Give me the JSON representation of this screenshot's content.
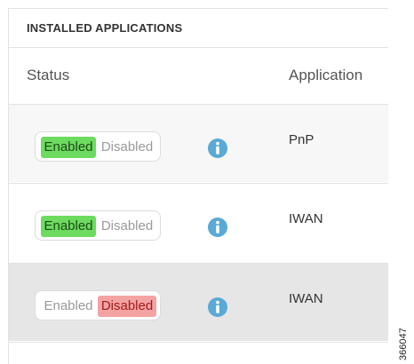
{
  "panel": {
    "title": "INSTALLED APPLICATIONS",
    "columns": {
      "status": "Status",
      "application": "Application"
    }
  },
  "rows": [
    {
      "enabled_label": "Enabled",
      "disabled_label": "Disabled",
      "state": "enabled",
      "info_icon": "info-icon",
      "application": "PnP"
    },
    {
      "enabled_label": "Enabled",
      "disabled_label": "Disabled",
      "state": "enabled",
      "info_icon": "info-icon",
      "application": "IWAN"
    },
    {
      "enabled_label": "Enabled",
      "disabled_label": "Disabled",
      "state": "disabled",
      "info_icon": "info-icon",
      "application": "IWAN"
    }
  ],
  "figure_id": "366047",
  "colors": {
    "enabled_active": "#6cdb5f",
    "disabled_active": "#f4a3a3",
    "info_icon": "#5aa9d6",
    "selected_row": "#e6e6e6"
  }
}
